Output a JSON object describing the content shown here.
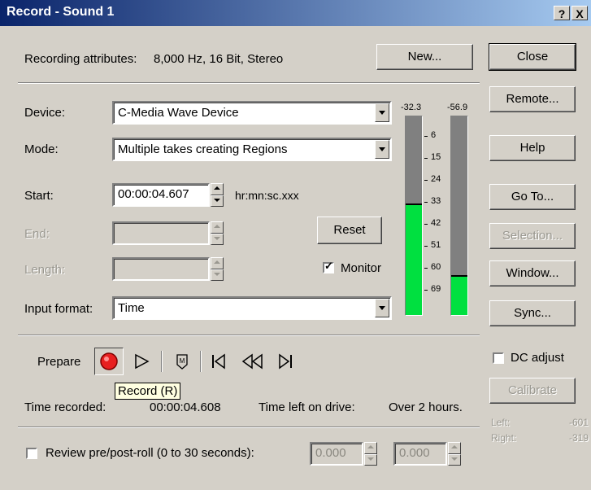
{
  "window": {
    "title": "Record - Sound 1",
    "help_btn": "?",
    "close_btn": "X"
  },
  "attributes": {
    "label": "Recording attributes:",
    "value": "8,000 Hz, 16 Bit, Stereo"
  },
  "buttons": {
    "new": "New...",
    "close": "Close",
    "remote": "Remote...",
    "help": "Help",
    "goto": "Go To...",
    "selection": "Selection...",
    "window": "Window...",
    "sync": "Sync...",
    "reset": "Reset",
    "calibrate": "Calibrate"
  },
  "device": {
    "label": "Device:",
    "value": "C-Media Wave Device"
  },
  "mode": {
    "label": "Mode:",
    "value": "Multiple takes creating Regions"
  },
  "start": {
    "label": "Start:",
    "value": "00:00:04.607",
    "unit": "hr:mn:sc.xxx"
  },
  "end": {
    "label": "End:"
  },
  "length": {
    "label": "Length:"
  },
  "monitor": {
    "label": "Monitor",
    "checked": true
  },
  "input_format": {
    "label": "Input format:",
    "value": "Time"
  },
  "meters": {
    "left_peak": "-32.3",
    "right_peak": "-56.9",
    "ticks": [
      "6",
      "15",
      "24",
      "33",
      "42",
      "51",
      "60",
      "69"
    ],
    "left_level": 0.55,
    "right_level": 0.19
  },
  "transport": {
    "prepare": "Prepare",
    "tooltip": "Record (R)"
  },
  "status": {
    "time_recorded_label": "Time recorded:",
    "time_recorded_value": "00:00:04.608",
    "time_left_label": "Time left on drive:",
    "time_left_value": "Over 2 hours."
  },
  "dc_adjust": {
    "label": "DC adjust",
    "checked": false
  },
  "calib": {
    "left_label": "Left:",
    "left_value": "-601",
    "right_label": "Right:",
    "right_value": "-319"
  },
  "review": {
    "label": "Review pre/post-roll (0 to 30 seconds):",
    "checked": false,
    "pre": "0.000",
    "post": "0.000"
  }
}
